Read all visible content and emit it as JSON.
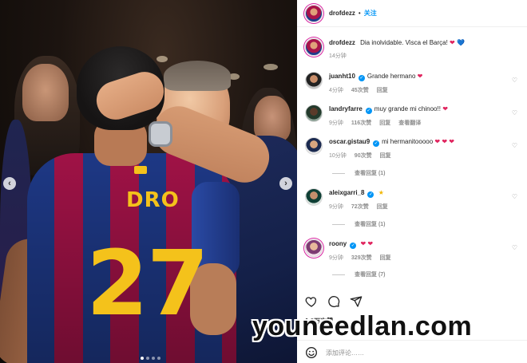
{
  "post": {
    "author": "drofdezz",
    "follow_label": "关注",
    "caption": "Dia inolvidable. Visca el Barça!",
    "caption_emojis": [
      "❤",
      "💙"
    ],
    "caption_time": "14分钟",
    "photo": {
      "jersey_name": "DRO",
      "jersey_number": "27",
      "carousel_total": 4,
      "carousel_active": 1
    }
  },
  "comments": [
    {
      "username": "juanht10",
      "verified": true,
      "text": "Grande hermano",
      "emoji": "❤",
      "time": "4分钟",
      "likes": "45次赞",
      "reply": "回复",
      "translate": ""
    },
    {
      "username": "landryfarre",
      "verified": true,
      "text": "muy grande mi chinoo!!",
      "emoji": "❤",
      "time": "9分钟",
      "likes": "116次赞",
      "reply": "回复",
      "translate": "查看翻译"
    },
    {
      "username": "oscar.gistau9",
      "verified": true,
      "text": "mi hermanitooooo",
      "emoji": "❤ ❤ ❤",
      "time": "10分钟",
      "likes": "90次赞",
      "reply": "回复",
      "translate": "",
      "view_replies": "查看回复 (1)"
    },
    {
      "username": "aleixgarri_8",
      "verified": true,
      "text": "",
      "emoji": "★",
      "time": "9分钟",
      "likes": "72次赞",
      "reply": "回复",
      "translate": "",
      "view_replies_above": "查看回复 (1)",
      "view_replies": "查看回复 (1)"
    },
    {
      "username": "roony",
      "verified": true,
      "text": "",
      "emoji": "❤ ❤",
      "time": "9分钟",
      "likes": "329次赞",
      "reply": "回复",
      "translate": "",
      "view_replies": "查看回复 (7)"
    }
  ],
  "actions": {
    "like_icon": "heart-icon",
    "comment_icon": "comment-icon",
    "share_icon": "share-icon",
    "likes_count": "1.3万次赞"
  },
  "composer": {
    "emoji_icon": "smiley-icon",
    "placeholder": "添加评论……"
  },
  "watermark": "youneedlan.com",
  "colors": {
    "link_blue": "#0095f6",
    "heart_red": "#e0245e",
    "meta_gray": "#8e8e8e"
  }
}
